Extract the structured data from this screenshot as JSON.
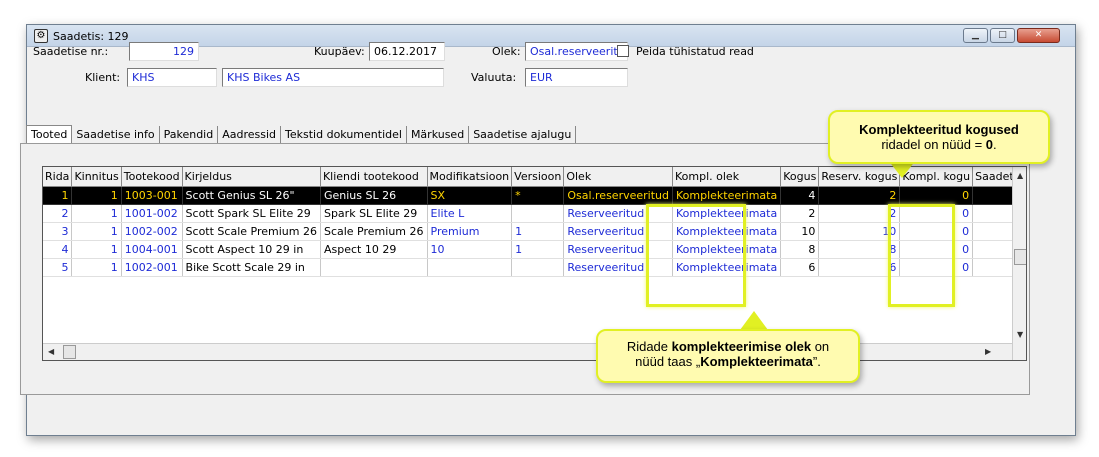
{
  "window": {
    "title": "Saadetis: 129",
    "btn_min": "▁",
    "btn_max": "□",
    "btn_close": "✕"
  },
  "form": {
    "shipment_no_label": "Saadetise nr.:",
    "shipment_no": "129",
    "date_label": "Kuupäev:",
    "date": "06.12.2017",
    "status_label": "Olek:",
    "status": "Osal.reserveeritud",
    "hide_label": "Peida tühistatud read",
    "client_label": "Klient:",
    "client_code": "KHS",
    "client_name": "KHS Bikes AS",
    "currency_label": "Valuuta:",
    "currency": "EUR"
  },
  "tabs": [
    "Tooted",
    "Saadetise info",
    "Pakendid",
    "Aadressid",
    "Tekstid dokumentidel",
    "Märkused",
    "Saadetise ajalugu"
  ],
  "table": {
    "columns": [
      "Rida",
      "Kinnitus",
      "Tootekood",
      "Kirjeldus",
      "Kliendi tootekood",
      "Modifikatsioon",
      "Versioon",
      "Olek",
      "Kompl. olek",
      "Kogus",
      "Reserv. kogus",
      "Kompl. kogu",
      "Saadetud"
    ],
    "rows": [
      {
        "rida": "1",
        "kinnitus": "1",
        "tootekood": "1003-001",
        "kirjeldus": "Scott Genius SL 26\"",
        "kliendi": "Genius SL 26",
        "mod": "SX",
        "versioon": "*",
        "olek": "Osal.reserveeritud",
        "kompl_olek": "Komplekteerimata",
        "kogus": "4",
        "reserv": "2",
        "kompl_kogus": "0",
        "saadetud": ""
      },
      {
        "rida": "2",
        "kinnitus": "1",
        "tootekood": "1001-002",
        "kirjeldus": "Scott Spark SL Elite 29",
        "kliendi": "Spark SL Elite 29",
        "mod": "Elite L",
        "versioon": "",
        "olek": "Reserveeritud",
        "kompl_olek": "Komplekteerimata",
        "kogus": "2",
        "reserv": "2",
        "kompl_kogus": "0",
        "saadetud": ""
      },
      {
        "rida": "3",
        "kinnitus": "1",
        "tootekood": "1002-002",
        "kirjeldus": "Scott Scale Premium 26",
        "kliendi": "Scale Premium 26",
        "mod": "Premium",
        "versioon": "1",
        "olek": "Reserveeritud",
        "kompl_olek": "Komplekteerimata",
        "kogus": "10",
        "reserv": "10",
        "kompl_kogus": "0",
        "saadetud": ""
      },
      {
        "rida": "4",
        "kinnitus": "1",
        "tootekood": "1004-001",
        "kirjeldus": "Scott Aspect 10 29 in",
        "kliendi": "Aspect 10 29",
        "mod": "10",
        "versioon": "1",
        "olek": "Reserveeritud",
        "kompl_olek": "Komplekteerimata",
        "kogus": "8",
        "reserv": "8",
        "kompl_kogus": "0",
        "saadetud": ""
      },
      {
        "rida": "5",
        "kinnitus": "1",
        "tootekood": "1002-001",
        "kirjeldus": "Bike Scott Scale 29 in",
        "kliendi": "",
        "mod": "",
        "versioon": "",
        "olek": "Reserveeritud",
        "kompl_olek": "Komplekteerimata",
        "kogus": "6",
        "reserv": "6",
        "kompl_kogus": "0",
        "saadetud": ""
      }
    ]
  },
  "callouts": {
    "top_bold": "Komplekteeritud kogused",
    "top_text": "ridadel on nüüd = ",
    "top_value": "0",
    "top_end": ".",
    "bottom_pre": "Ridade ",
    "bottom_bold": "komplekteerimise olek",
    "bottom_mid": " on",
    "bottom_line2_pre": "nüüd taas „",
    "bottom_bold2": "Komplekteerimata",
    "bottom_end": "”."
  },
  "colors": {
    "highlight": "#e1f023",
    "callout_bg": "#fffbb0",
    "link_blue": "#1e2bd6",
    "selected_text": "#ffd400"
  }
}
